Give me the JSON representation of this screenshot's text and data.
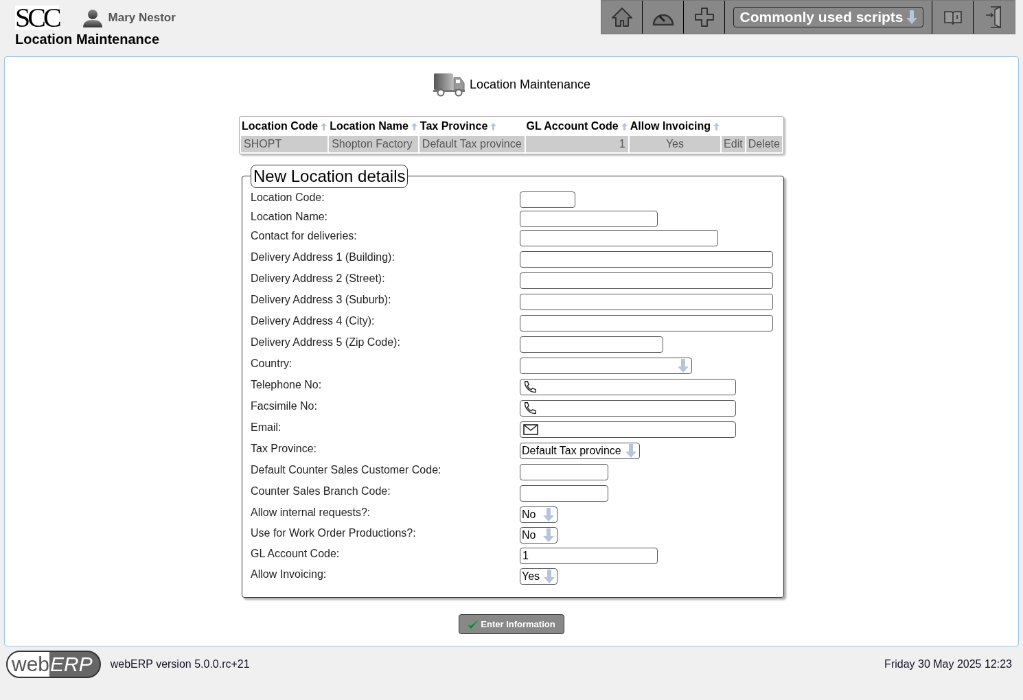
{
  "header": {
    "logo": "SCC",
    "user": "Mary Nestor",
    "page_title": "Location Maintenance",
    "scripts_menu": "Commonly used scripts"
  },
  "heading": "Location Maintenance",
  "table": {
    "columns": [
      "Location Code",
      "Location Name",
      "Tax Province",
      "GL Account Code",
      "Allow Invoicing"
    ],
    "rows": [
      {
        "cells": [
          "SHOPT",
          "Shopton Factory",
          "Default Tax province",
          "1",
          "Yes"
        ],
        "actions": [
          "Edit",
          "Delete"
        ]
      }
    ]
  },
  "form": {
    "legend": "New Location details",
    "fields": [
      {
        "label": "Location Code:",
        "kind": "text"
      },
      {
        "label": "Location Name:",
        "kind": "text"
      },
      {
        "label": "Contact for deliveries:",
        "kind": "text"
      },
      {
        "label": "Delivery Address 1 (Building):",
        "kind": "text"
      },
      {
        "label": "Delivery Address 2 (Street):",
        "kind": "text"
      },
      {
        "label": "Delivery Address 3 (Suburb):",
        "kind": "text"
      },
      {
        "label": "Delivery Address 4 (City):",
        "kind": "text"
      },
      {
        "label": "Delivery Address 5 (Zip Code):",
        "kind": "text"
      },
      {
        "label": "Country:",
        "kind": "select"
      },
      {
        "label": "Telephone No:",
        "kind": "phone"
      },
      {
        "label": "Facsimile No:",
        "kind": "phone"
      },
      {
        "label": "Email:",
        "kind": "email"
      },
      {
        "label": "Tax Province:",
        "kind": "select",
        "value": "Default Tax province"
      },
      {
        "label": "Default Counter Sales Customer Code:",
        "kind": "text"
      },
      {
        "label": "Counter Sales Branch Code:",
        "kind": "text"
      },
      {
        "label": "Allow internal requests?:",
        "kind": "select",
        "value": "No"
      },
      {
        "label": "Use for Work Order Productions?:",
        "kind": "select",
        "value": "No"
      },
      {
        "label": "GL Account Code:",
        "kind": "text",
        "value": "1"
      },
      {
        "label": "Allow Invoicing:",
        "kind": "select",
        "value": "Yes"
      }
    ],
    "submit": "Enter Information"
  },
  "footer": {
    "logo_left": "web",
    "logo_right": "ERP",
    "version": "webERP version 5.0.0.rc+21",
    "datetime": "Friday 30 May 2025 12:23"
  }
}
